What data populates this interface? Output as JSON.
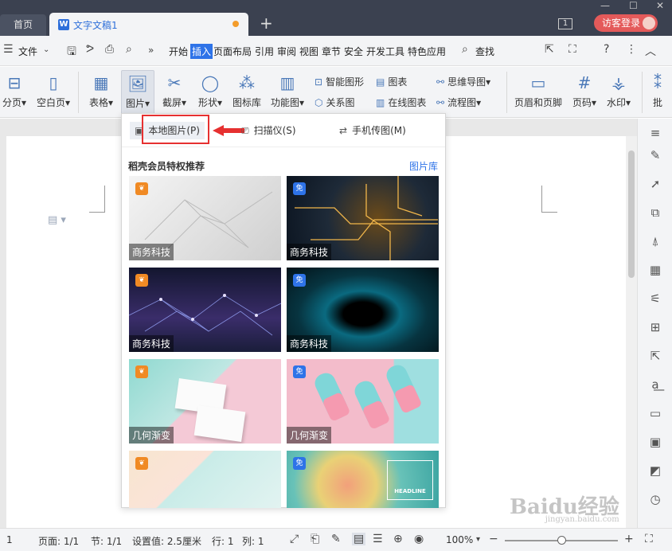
{
  "tabs": {
    "home": "首页",
    "doc": "文字文稿1",
    "add": "+"
  },
  "topright": {
    "badge": "1",
    "login": "访客登录"
  },
  "menu": {
    "file": "文件",
    "items": [
      "开始",
      "插入",
      "页面布局",
      "引用",
      "审阅",
      "视图",
      "章节",
      "安全",
      "开发工具",
      "特色应用"
    ],
    "active": "插入",
    "search": "查找"
  },
  "ribbon": {
    "page_break": "分页",
    "blank_page": "空白页",
    "table": "表格",
    "picture": "图片",
    "screenshot": "截屏",
    "shape": "形状",
    "icon_lib": "图标库",
    "func_chart": "功能图",
    "smart_shape": "智能图形",
    "chart": "图表",
    "relation": "关系图",
    "online_chart": "在线图表",
    "mindmap": "思维导图",
    "flowchart": "流程图",
    "header_footer": "页眉和页脚",
    "page_num": "页码",
    "watermark": "水印",
    "more": "批"
  },
  "dropdown": {
    "local_picture": "本地图片(P)",
    "scanner": "扫描仪(S)",
    "phone_transfer": "手机传图(M)",
    "section_title": "稻壳会员特权推荐",
    "library_link": "图片库",
    "cards": [
      {
        "caption": "商务科技",
        "badge": "vip"
      },
      {
        "caption": "商务科技",
        "badge": "免"
      },
      {
        "caption": "商务科技",
        "badge": "vip"
      },
      {
        "caption": "商务科技",
        "badge": "免"
      },
      {
        "caption": "几何渐变",
        "badge": "vip"
      },
      {
        "caption": "几何渐变",
        "badge": "免"
      },
      {
        "caption": "",
        "badge": "vip"
      },
      {
        "caption": "",
        "badge": "免",
        "inner_text": "HEADLINE"
      }
    ]
  },
  "status": {
    "page_num": "1",
    "pages": "页面: 1/1",
    "section": "节: 1/1",
    "setting": "设置值: 2.5厘米",
    "row": "行: 1",
    "col": "列: 1",
    "zoom": "100%",
    "zoom_level": 1.0
  },
  "watermark": {
    "text": "Baidu经验",
    "url": "jingyan.baidu.com"
  },
  "colors": {
    "accent": "#2e73e8",
    "tabbar": "#3b4150",
    "login": "#e45a5a",
    "highlight_box": "#e63030"
  }
}
